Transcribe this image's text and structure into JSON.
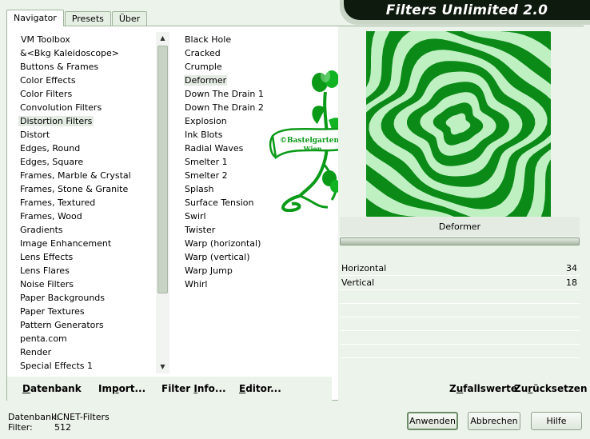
{
  "window": {
    "title": "Filters Unlimited 2.0",
    "tabs": [
      "Navigator",
      "Presets",
      "Über"
    ],
    "active_tab": "Navigator"
  },
  "categories": {
    "items": [
      "VM Toolbox",
      "&<Bkg Kaleidoscope>",
      "Buttons & Frames",
      "Color Effects",
      "Color Filters",
      "Convolution Filters",
      "Distortion Filters",
      "Distort",
      "Edges, Round",
      "Edges, Square",
      "Frames, Marble & Crystal",
      "Frames, Stone & Granite",
      "Frames, Textured",
      "Frames, Wood",
      "Gradients",
      "Image Enhancement",
      "Lens Effects",
      "Lens Flares",
      "Noise Filters",
      "Paper Backgrounds",
      "Paper Textures",
      "Pattern Generators",
      "penta.com",
      "Render",
      "Special Effects 1"
    ],
    "selected": "Distortion Filters"
  },
  "filters": {
    "items": [
      "Black Hole",
      "Cracked",
      "Crumple",
      "Deformer",
      "Down The Drain 1",
      "Down The Drain 2",
      "Explosion",
      "Ink Blots",
      "Radial Waves",
      "Smelter 1",
      "Smelter 2",
      "Splash",
      "Surface Tension",
      "Swirl",
      "Twister",
      "Warp (horizontal)",
      "Warp (vertical)",
      "Warp Jump",
      "Whirl"
    ],
    "selected": "Deformer"
  },
  "logo": {
    "line1": "©Bastelgarten",
    "line2": "Wien"
  },
  "preview": {
    "filter_name": "Deformer"
  },
  "params": [
    {
      "label": "Horizontal",
      "value": "34"
    },
    {
      "label": "Vertical",
      "value": "18"
    }
  ],
  "toolbar": {
    "datenbank": {
      "u": "D",
      "rest": "atenbank"
    },
    "import": {
      "pre": "Im",
      "u": "p",
      "rest": "ort..."
    },
    "filter_info": {
      "pre": "Filter ",
      "u": "I",
      "rest": "nfo..."
    },
    "editor": {
      "u": "E",
      "rest": "ditor..."
    },
    "zufallswerte": {
      "pre": "Z",
      "u": "u",
      "rest": "fallswerte"
    },
    "zuruecksetzen": {
      "pre": "Zu",
      "u": "r",
      "rest": "ücksetzen"
    }
  },
  "status": {
    "db_label": "Datenbank:",
    "db_value": "ICNET-Filters",
    "filter_label": "Filter:",
    "filter_value": "512"
  },
  "buttons": {
    "anwenden": "Anwenden",
    "abbrechen": "Abbrechen",
    "hilfe": "Hilfe"
  },
  "colors": {
    "accent_green": "#0b8a17",
    "light_green": "#ecf3ea",
    "banner": "#0f1a0f"
  }
}
